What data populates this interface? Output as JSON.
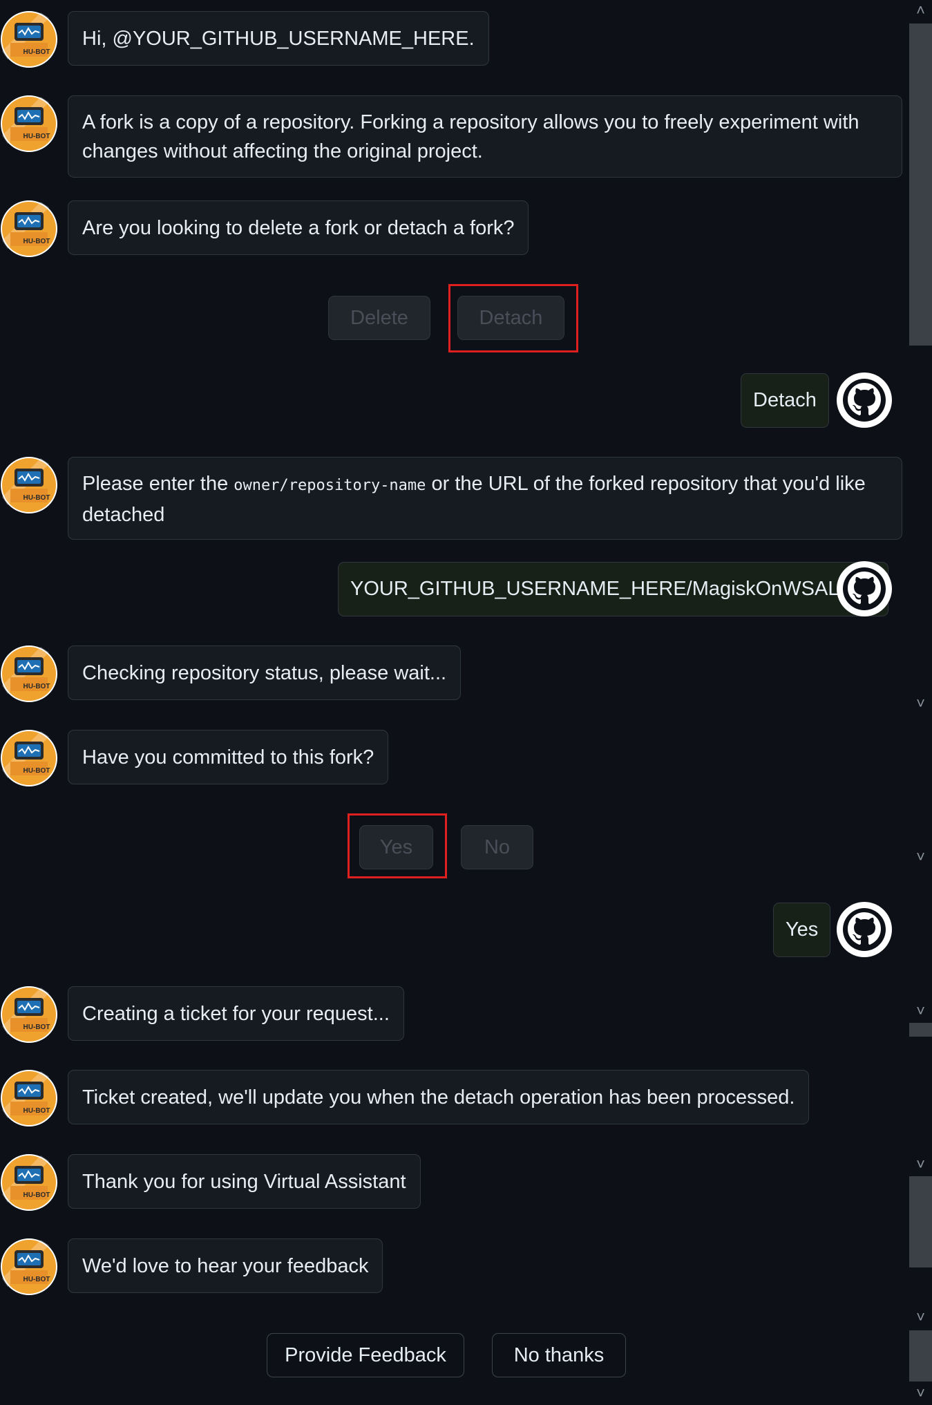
{
  "bot_avatar_label": "HU-BOT",
  "messages": {
    "m1": "Hi, @YOUR_GITHUB_USERNAME_HERE.",
    "m2": "A fork is a copy of a repository. Forking a repository allows you to freely experiment with changes without affecting the original project.",
    "m3": "Are you looking to delete a fork or detach a fork?",
    "m4_before": "Please enter the ",
    "m4_code": "owner/repository-name",
    "m4_after": " or the URL of the forked repository that you'd like detached",
    "m5": "Checking repository status, please wait...",
    "m6": "Have you committed to this fork?",
    "m7": "Creating a ticket for your request...",
    "m8": "Ticket created, we'll update you when the detach operation has been processed.",
    "m9": "Thank you for using Virtual Assistant",
    "m10": "We'd love to hear your feedback"
  },
  "choices": {
    "delete": "Delete",
    "detach": "Detach",
    "yes": "Yes",
    "no": "No"
  },
  "user_replies": {
    "r1": "Detach",
    "r2": "YOUR_GITHUB_USERNAME_HERE/MagiskOnWSALocal",
    "r3": "Yes"
  },
  "actions": {
    "provide_feedback": "Provide Feedback",
    "no_thanks": "No thanks"
  },
  "colors": {
    "background": "#0d1117",
    "bubble": "#161b22",
    "user_bubble": "#172118",
    "highlight": "#e01f1f",
    "bot_avatar": "#f0a22e"
  }
}
